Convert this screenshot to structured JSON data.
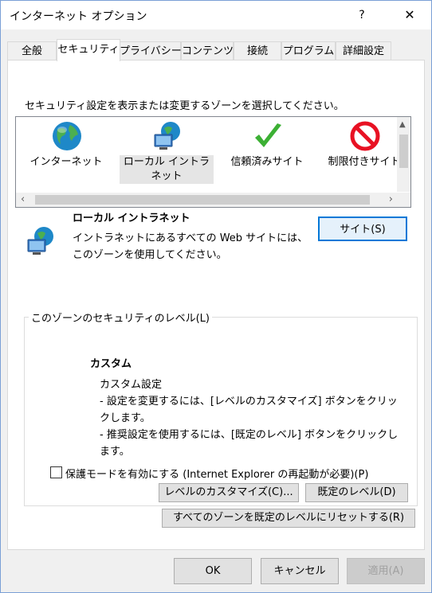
{
  "window": {
    "title": "インターネット オプション",
    "help_glyph": "?",
    "close_glyph": "✕"
  },
  "tabs": [
    {
      "label": "全般"
    },
    {
      "label": "セキュリティ"
    },
    {
      "label": "プライバシー"
    },
    {
      "label": "コンテンツ"
    },
    {
      "label": "接続"
    },
    {
      "label": "プログラム"
    },
    {
      "label": "詳細設定"
    }
  ],
  "security": {
    "instruction": "セキュリティ設定を表示または変更するゾーンを選択してください。",
    "zones": [
      {
        "label": "インターネット",
        "icon": "globe-icon"
      },
      {
        "label": "ローカル イントラネット",
        "icon": "intranet-icon",
        "selected": true
      },
      {
        "label": "信頼済みサイト",
        "icon": "checkmark-icon"
      },
      {
        "label": "制限付きサイト",
        "icon": "restricted-icon"
      }
    ],
    "selected_zone": {
      "name": "ローカル イントラネット",
      "description": "イントラネットにあるすべての Web サイトには、このゾーンを使用してください。",
      "sites_button": "サイト(S)"
    },
    "level_group": {
      "title": "このゾーンのセキュリティのレベル(L)",
      "level_name": "カスタム",
      "level_desc_1": "カスタム設定",
      "level_desc_2": "- 設定を変更するには、[レベルのカスタマイズ] ボタンをクリックします。",
      "level_desc_3": "- 推奨設定を使用するには、[既定のレベル] ボタンをクリックします。",
      "protected_mode_label": "保護モードを有効にする (Internet Explorer の再起動が必要)(P)",
      "protected_mode_checked": false,
      "custom_level_button": "レベルのカスタマイズ(C)...",
      "default_level_button": "既定のレベル(D)"
    },
    "reset_all_button": "すべてのゾーンを既定のレベルにリセットする(R)"
  },
  "footer": {
    "ok": "OK",
    "cancel": "キャンセル",
    "apply": "適用(A)"
  },
  "colors": {
    "accent": "#0078d7",
    "restricted_red": "#e81123",
    "check_green": "#3cb034"
  }
}
